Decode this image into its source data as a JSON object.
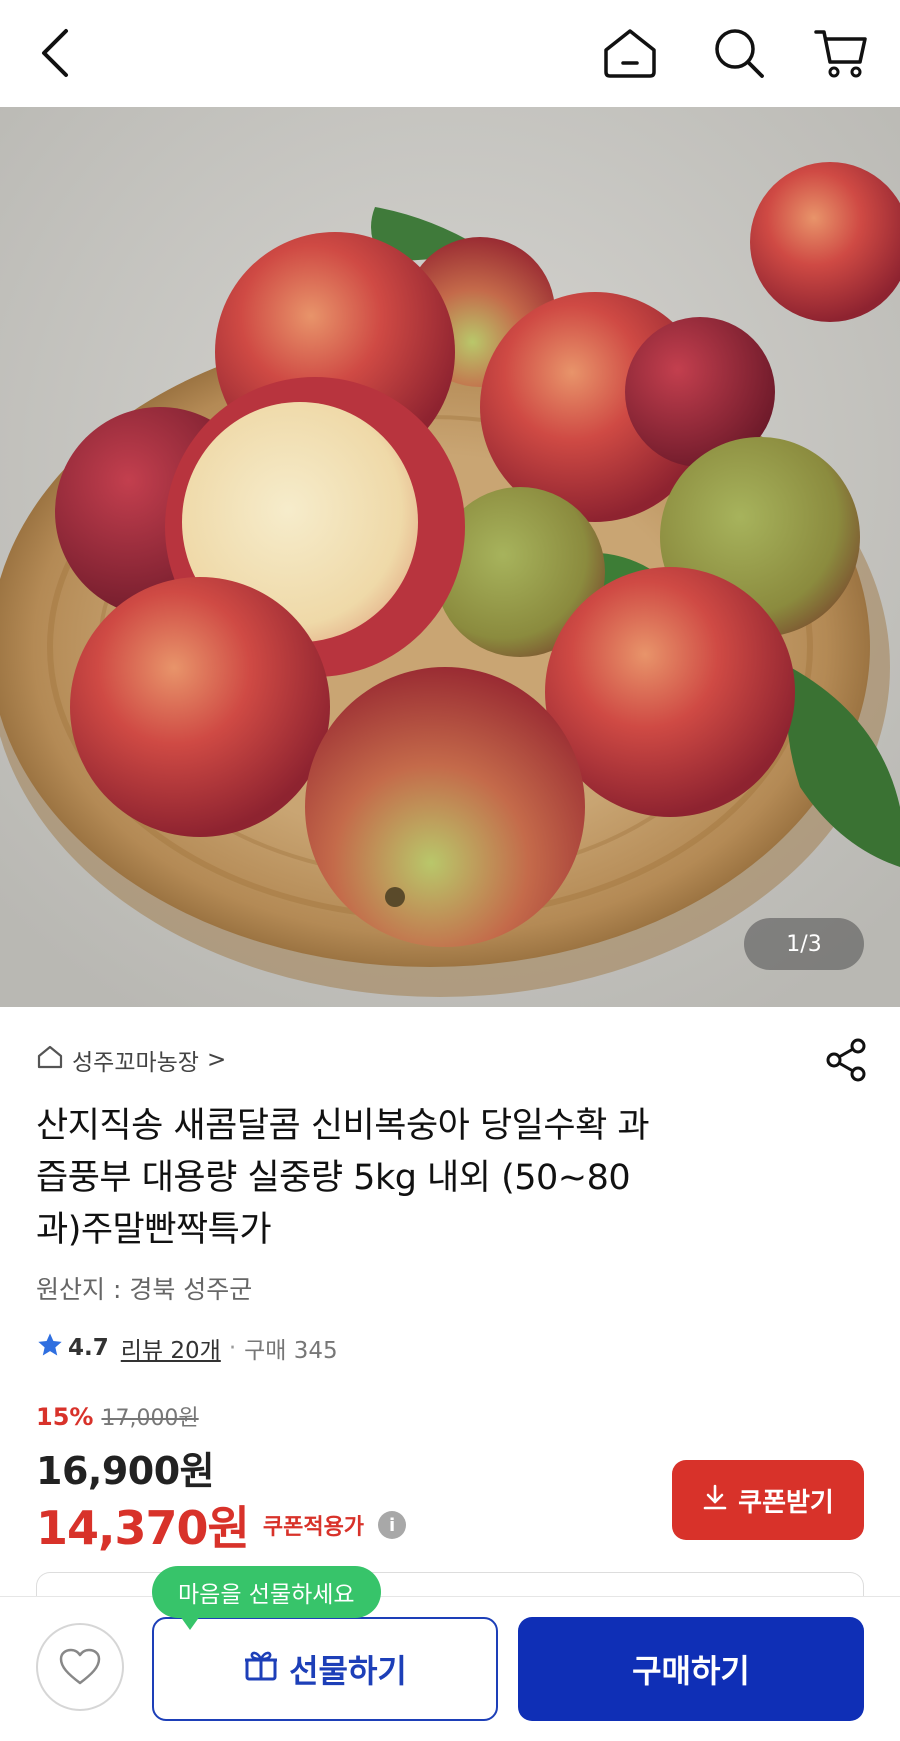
{
  "header": {
    "icons": [
      "back-icon",
      "home-icon",
      "search-icon",
      "cart-icon"
    ]
  },
  "gallery": {
    "counter": "1/3"
  },
  "product": {
    "store_name": "성주꼬마농장",
    "store_chevron": ">",
    "title_lines": [
      "산지직송 새콤달콤 신비복숭아 당일수확 과",
      "즙풍부 대용량 실중량 5kg 내외 (50~80",
      "과)주말빤짝특가"
    ],
    "origin": "원산지 : 경북 성주군",
    "rating": "4.7",
    "review": "리뷰 20개",
    "separator": "·",
    "purchases": "구매 345",
    "discount_rate": "15%",
    "original_price": "17,000원",
    "price": "16,900원",
    "coupon_price": "14,370원",
    "coupon_note": "쿠폰적용가",
    "info_glyph": "i"
  },
  "coupon_button": {
    "label": "쿠폰받기"
  },
  "bottom_bar": {
    "tooltip": "마음을 선물하세요",
    "gift_label": "선물하기",
    "buy_label": "구매하기"
  },
  "colors": {
    "accent_red": "#d8322a",
    "primary_blue": "#0f2fb6",
    "tooltip_green": "#37c46a",
    "star_blue": "#2f6fe0"
  }
}
